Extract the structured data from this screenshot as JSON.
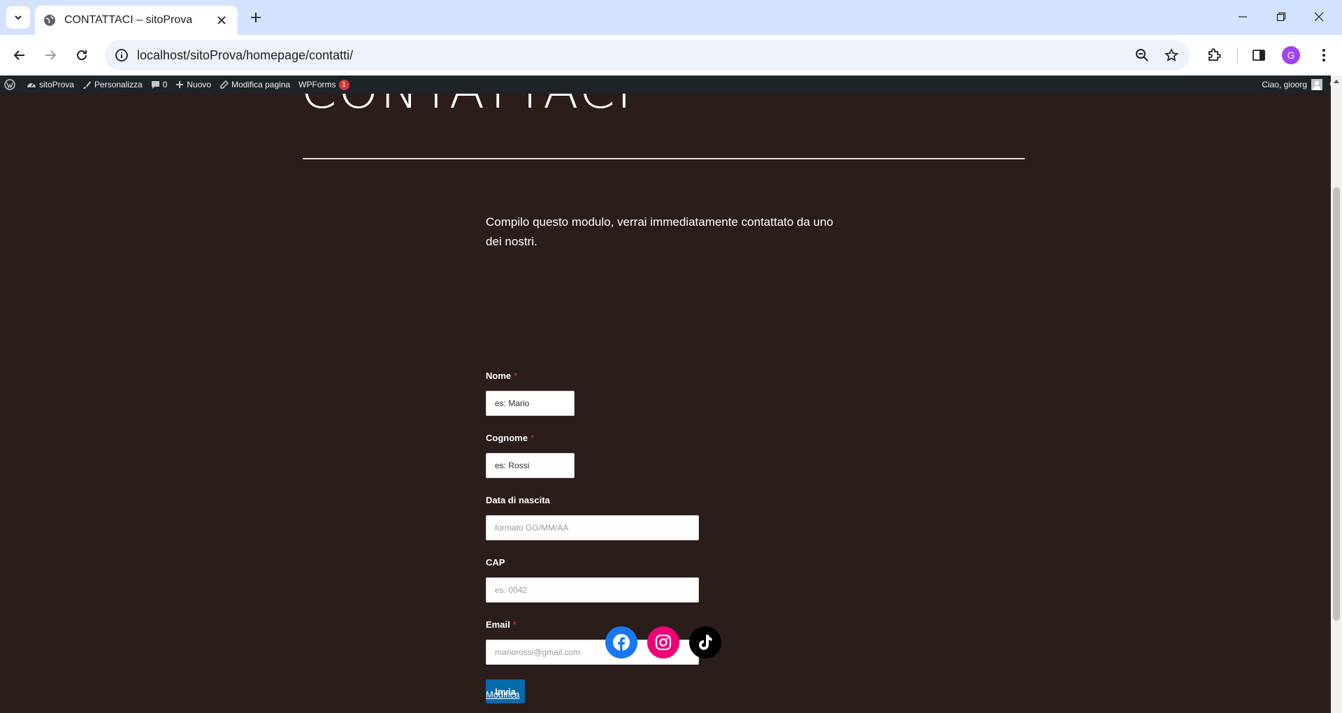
{
  "browser": {
    "tab_title": "CONTATTACI – sitoProva",
    "url": "localhost/sitoProva/homepage/contatti/",
    "profile_initial": "G"
  },
  "adminbar": {
    "site_name": "sitoProva",
    "customize": "Personalizza",
    "comments_count": "0",
    "new": "Nuovo",
    "edit_page": "Modifica pagina",
    "wpforms": "WPForms",
    "wpforms_badge": "1",
    "greeting": "Ciao, gioorg"
  },
  "page": {
    "title": "CONTATTACI",
    "intro": "Compilo questo modulo, verrai immediatamente contattato da uno dei nostri.",
    "form": {
      "nome": {
        "label": "Nome",
        "required_mark": "*",
        "value": "es: Mario"
      },
      "cognome": {
        "label": "Cognome",
        "required_mark": "*",
        "value": "es: Rossi"
      },
      "data_nascita": {
        "label": "Data di nascita",
        "placeholder": "formato GG/MM/AA"
      },
      "cap": {
        "label": "CAP",
        "placeholder": "es: 0042"
      },
      "email": {
        "label": "Email",
        "required_mark": "*",
        "placeholder": "mariorossi@gmail.com"
      },
      "submit_label": "Invia"
    },
    "socials": [
      {
        "name": "facebook",
        "color": "#1877f2"
      },
      {
        "name": "instagram",
        "color": "#f00075"
      },
      {
        "name": "tiktok",
        "color": "#000000"
      }
    ],
    "edit_link": "Modifica"
  },
  "colors": {
    "page_bg": "#2a1d1a",
    "button_blue": "#066aab",
    "required_red": "#d63638",
    "adminbar_bg": "#1d2327"
  }
}
